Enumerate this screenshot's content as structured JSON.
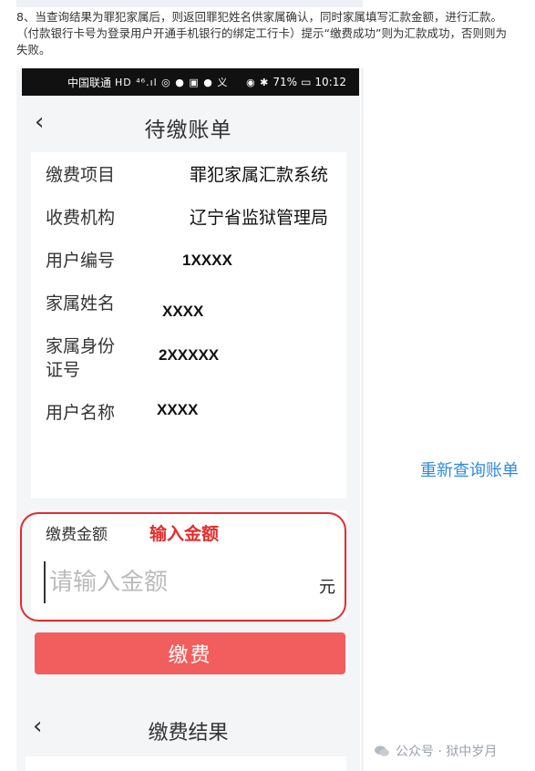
{
  "instruction": "8、当查询结果为罪犯家属后，则返回罪犯姓名供家属确认，同时家属填写汇款金额，进行汇款。（付款银行卡号为登录用户开通手机银行的绑定工行卡）提示“缴费成功”则为汇款成功，否则则为失败。",
  "status_bar": {
    "carrier": "中国联通",
    "icons_left": "HD ⁴⁶.ıl ◎ ● ▣ ● 义",
    "icons_right": "◉ ✱",
    "battery": "71%",
    "time": "10:12"
  },
  "bill_page": {
    "title": "待缴账单",
    "rows": [
      {
        "label": "缴费项目",
        "value": "罪犯家属汇款系统"
      },
      {
        "label": "收费机构",
        "value": "辽宁省监狱管理局"
      },
      {
        "label": "用户编号",
        "value": "1XXXX"
      },
      {
        "label": "家属姓名",
        "value": "XXXX"
      },
      {
        "label": "家属身份证号",
        "label_line1": "家属身份",
        "label_line2": "证号",
        "value": "2XXXXX"
      },
      {
        "label": "用户名称",
        "value": "XXXX"
      }
    ],
    "requery_link": "重新查询账单",
    "amount": {
      "label": "缴费金额",
      "annotation": "输入金额",
      "placeholder": "请输入金额",
      "value": "",
      "unit": "元"
    },
    "pay_button": "缴费"
  },
  "result_page": {
    "title": "缴费结果"
  },
  "watermark": "公众号 · 狱中岁月",
  "colors": {
    "accent_blue": "#2f8be0",
    "highlight_red": "#e52b2b",
    "pay_button": "#f25d5d"
  }
}
